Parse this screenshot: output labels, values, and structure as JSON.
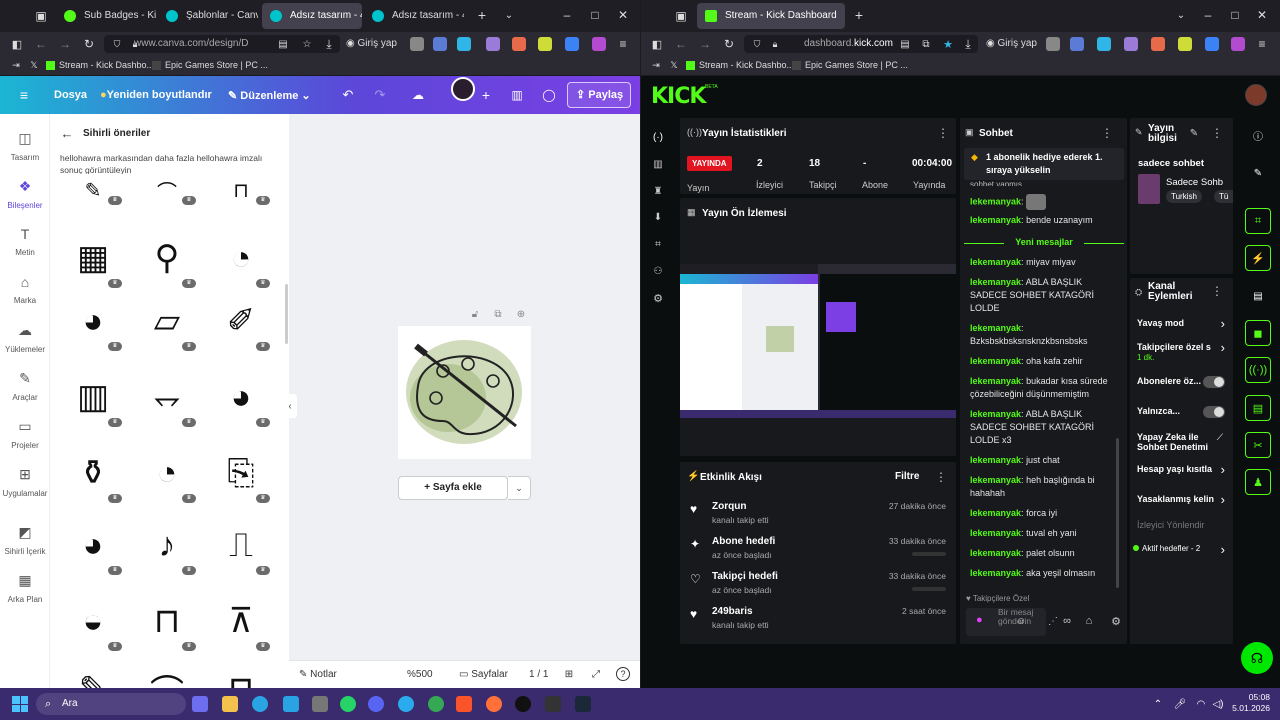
{
  "left_browser": {
    "tabs": [
      {
        "label": "Sub Badges - Kick",
        "active": false,
        "color": "#53fc18"
      },
      {
        "label": "Şablonlar - Canva",
        "active": false,
        "color": "#00c4cc"
      },
      {
        "label": "Adsız tasarım - 40",
        "active": true,
        "color": "#00c4cc"
      },
      {
        "label": "Adsız tasarım - 40",
        "active": false,
        "color": "#00c4cc"
      }
    ],
    "url": "www.canva.com/design/D",
    "signin": "Giriş yap",
    "bookmarks": [
      "Stream - Kick Dashbo...",
      "Epic Games Store | PC ..."
    ]
  },
  "right_browser": {
    "tabs": [
      {
        "label": "Stream - Kick Dashboard",
        "active": true,
        "color": "#53fc18"
      }
    ],
    "url_prefix": "dashboard.",
    "url_domain": "kick.com",
    "signin": "Giriş yap",
    "bookmarks": [
      "Stream - Kick Dashbo...",
      "Epic Games Store | PC ..."
    ]
  },
  "canva": {
    "toolbar": {
      "file": "Dosya",
      "resize": "Yeniden boyutlandır",
      "edit": "Düzenleme",
      "share": "Paylaş"
    },
    "rail": [
      "Tasarım",
      "Bileşenler",
      "Metin",
      "Marka",
      "Yüklemeler",
      "Araçlar",
      "Projeler",
      "Uygulamalar",
      "Sihirli İçerik",
      "Arka Plan"
    ],
    "panel": {
      "title": "Sihirli öneriler",
      "notice": "hellohawra markasından daha fazla hellohawra imzalı sonuç görüntüleyin"
    },
    "add_page": "+ Sayfa ekle",
    "footer": {
      "notes": "Notlar",
      "zoom": "%500",
      "pages": "Sayfalar",
      "page_count": "1 / 1"
    }
  },
  "kick": {
    "logo": "KICK",
    "logo_badge": "BETA",
    "stats": {
      "title": "Yayın İstatistikleri",
      "live_badge": "YAYINDA",
      "live_label": "Yayın",
      "viewers": "2",
      "viewers_label": "İzleyici",
      "followers": "18",
      "followers_label": "Takipçi",
      "subs": "-",
      "subs_label": "Abone",
      "time": "00:04:00",
      "time_label": "Yayında"
    },
    "preview_title": "Yayın Ön İzlemesi",
    "activity": {
      "title": "Etkinlik Akışı",
      "filter": "Filtre",
      "items": [
        {
          "name": "Zorqun",
          "sub": "kanalı takip etti",
          "time": "27 dakika önce",
          "icon": "♥"
        },
        {
          "name": "Abone hedefi",
          "sub": "az önce başladı",
          "time": "33 dakika önce",
          "icon": "✦"
        },
        {
          "name": "Takipçi hedefi",
          "sub": "az önce başladı",
          "time": "33 dakika önce",
          "icon": "♡"
        },
        {
          "name": "249baris",
          "sub": "kanalı takip etti",
          "time": "2 saat önce",
          "icon": "♥"
        }
      ]
    },
    "chat": {
      "title": "Sohbet",
      "pinned": "1 abonelik hediye ederek 1. sıraya yükselin",
      "partial": "sohbet yapmış",
      "new_messages": "Yeni mesajlar",
      "messages": [
        {
          "user": "lekemanyak",
          "text": ""
        },
        {
          "user": "lekemanyak",
          "text": "bende uzanayım"
        },
        {
          "user": "lekemanyak",
          "text": "miyav miyav"
        },
        {
          "user": "lekemanyak",
          "text": "ABLA BAŞLIK SADECE SOHBET KATAGÖRİ LOLDE"
        },
        {
          "user": "lekemanyak",
          "text": "Bzksbskbsksnsknzkbsnsbsks"
        },
        {
          "user": "lekemanyak",
          "text": "oha kafa zehir"
        },
        {
          "user": "lekemanyak",
          "text": "bukadar kısa sürede çözebiliceğini düşünmemiştim"
        },
        {
          "user": "lekemanyak",
          "text": "ABLA BAŞLIK SADECE SOHBET KATAGÖRİ LOLDE x3"
        },
        {
          "user": "lekemanyak",
          "text": "just chat"
        },
        {
          "user": "lekemanyak",
          "text": "heh başlığında bi hahahah"
        },
        {
          "user": "lekemanyak",
          "text": "forca iyi"
        },
        {
          "user": "lekemanyak",
          "text": "tuval eh yani"
        },
        {
          "user": "lekemanyak",
          "text": "palet olsunn"
        },
        {
          "user": "lekemanyak",
          "text": "aka yeşil olmasın"
        }
      ],
      "mode": "Takipçilere Özel",
      "input_placeholder": "Bir mesaj gönderin"
    },
    "info": {
      "title": "Yayın bilgisi",
      "stream_title": "sadece sohbet",
      "category": "Sadece Sohb",
      "tag1": "Turkish",
      "tag2": "Tü"
    },
    "channel_actions": {
      "title": "Kanal Eylemleri",
      "items": [
        {
          "label": "Yavaş mod",
          "extra": "",
          "control": "chevron"
        },
        {
          "label": "Takipçilere özel s",
          "extra": "1 dk.",
          "control": "chevron"
        },
        {
          "label": "Abonelere öz...",
          "extra": "",
          "control": "toggle"
        },
        {
          "label": "Yalnızca...",
          "extra": "",
          "control": "toggle"
        },
        {
          "label": "Yapay Zeka ile Sohbet Denetimi",
          "extra": "",
          "control": "chart"
        },
        {
          "label": "Hesap yaşı kısıtla",
          "extra": "",
          "control": "chevron"
        },
        {
          "label": "Yasaklanmış kelin",
          "extra": "",
          "control": "chevron"
        },
        {
          "label": "İzleyici Yönlendir",
          "extra": "",
          "control": "none"
        },
        {
          "label": "Aktif hedefler - 2",
          "extra": "",
          "control": "chevron"
        }
      ]
    }
  },
  "taskbar": {
    "search": "Ara",
    "time": "05:08",
    "date": "5.01.2026"
  }
}
